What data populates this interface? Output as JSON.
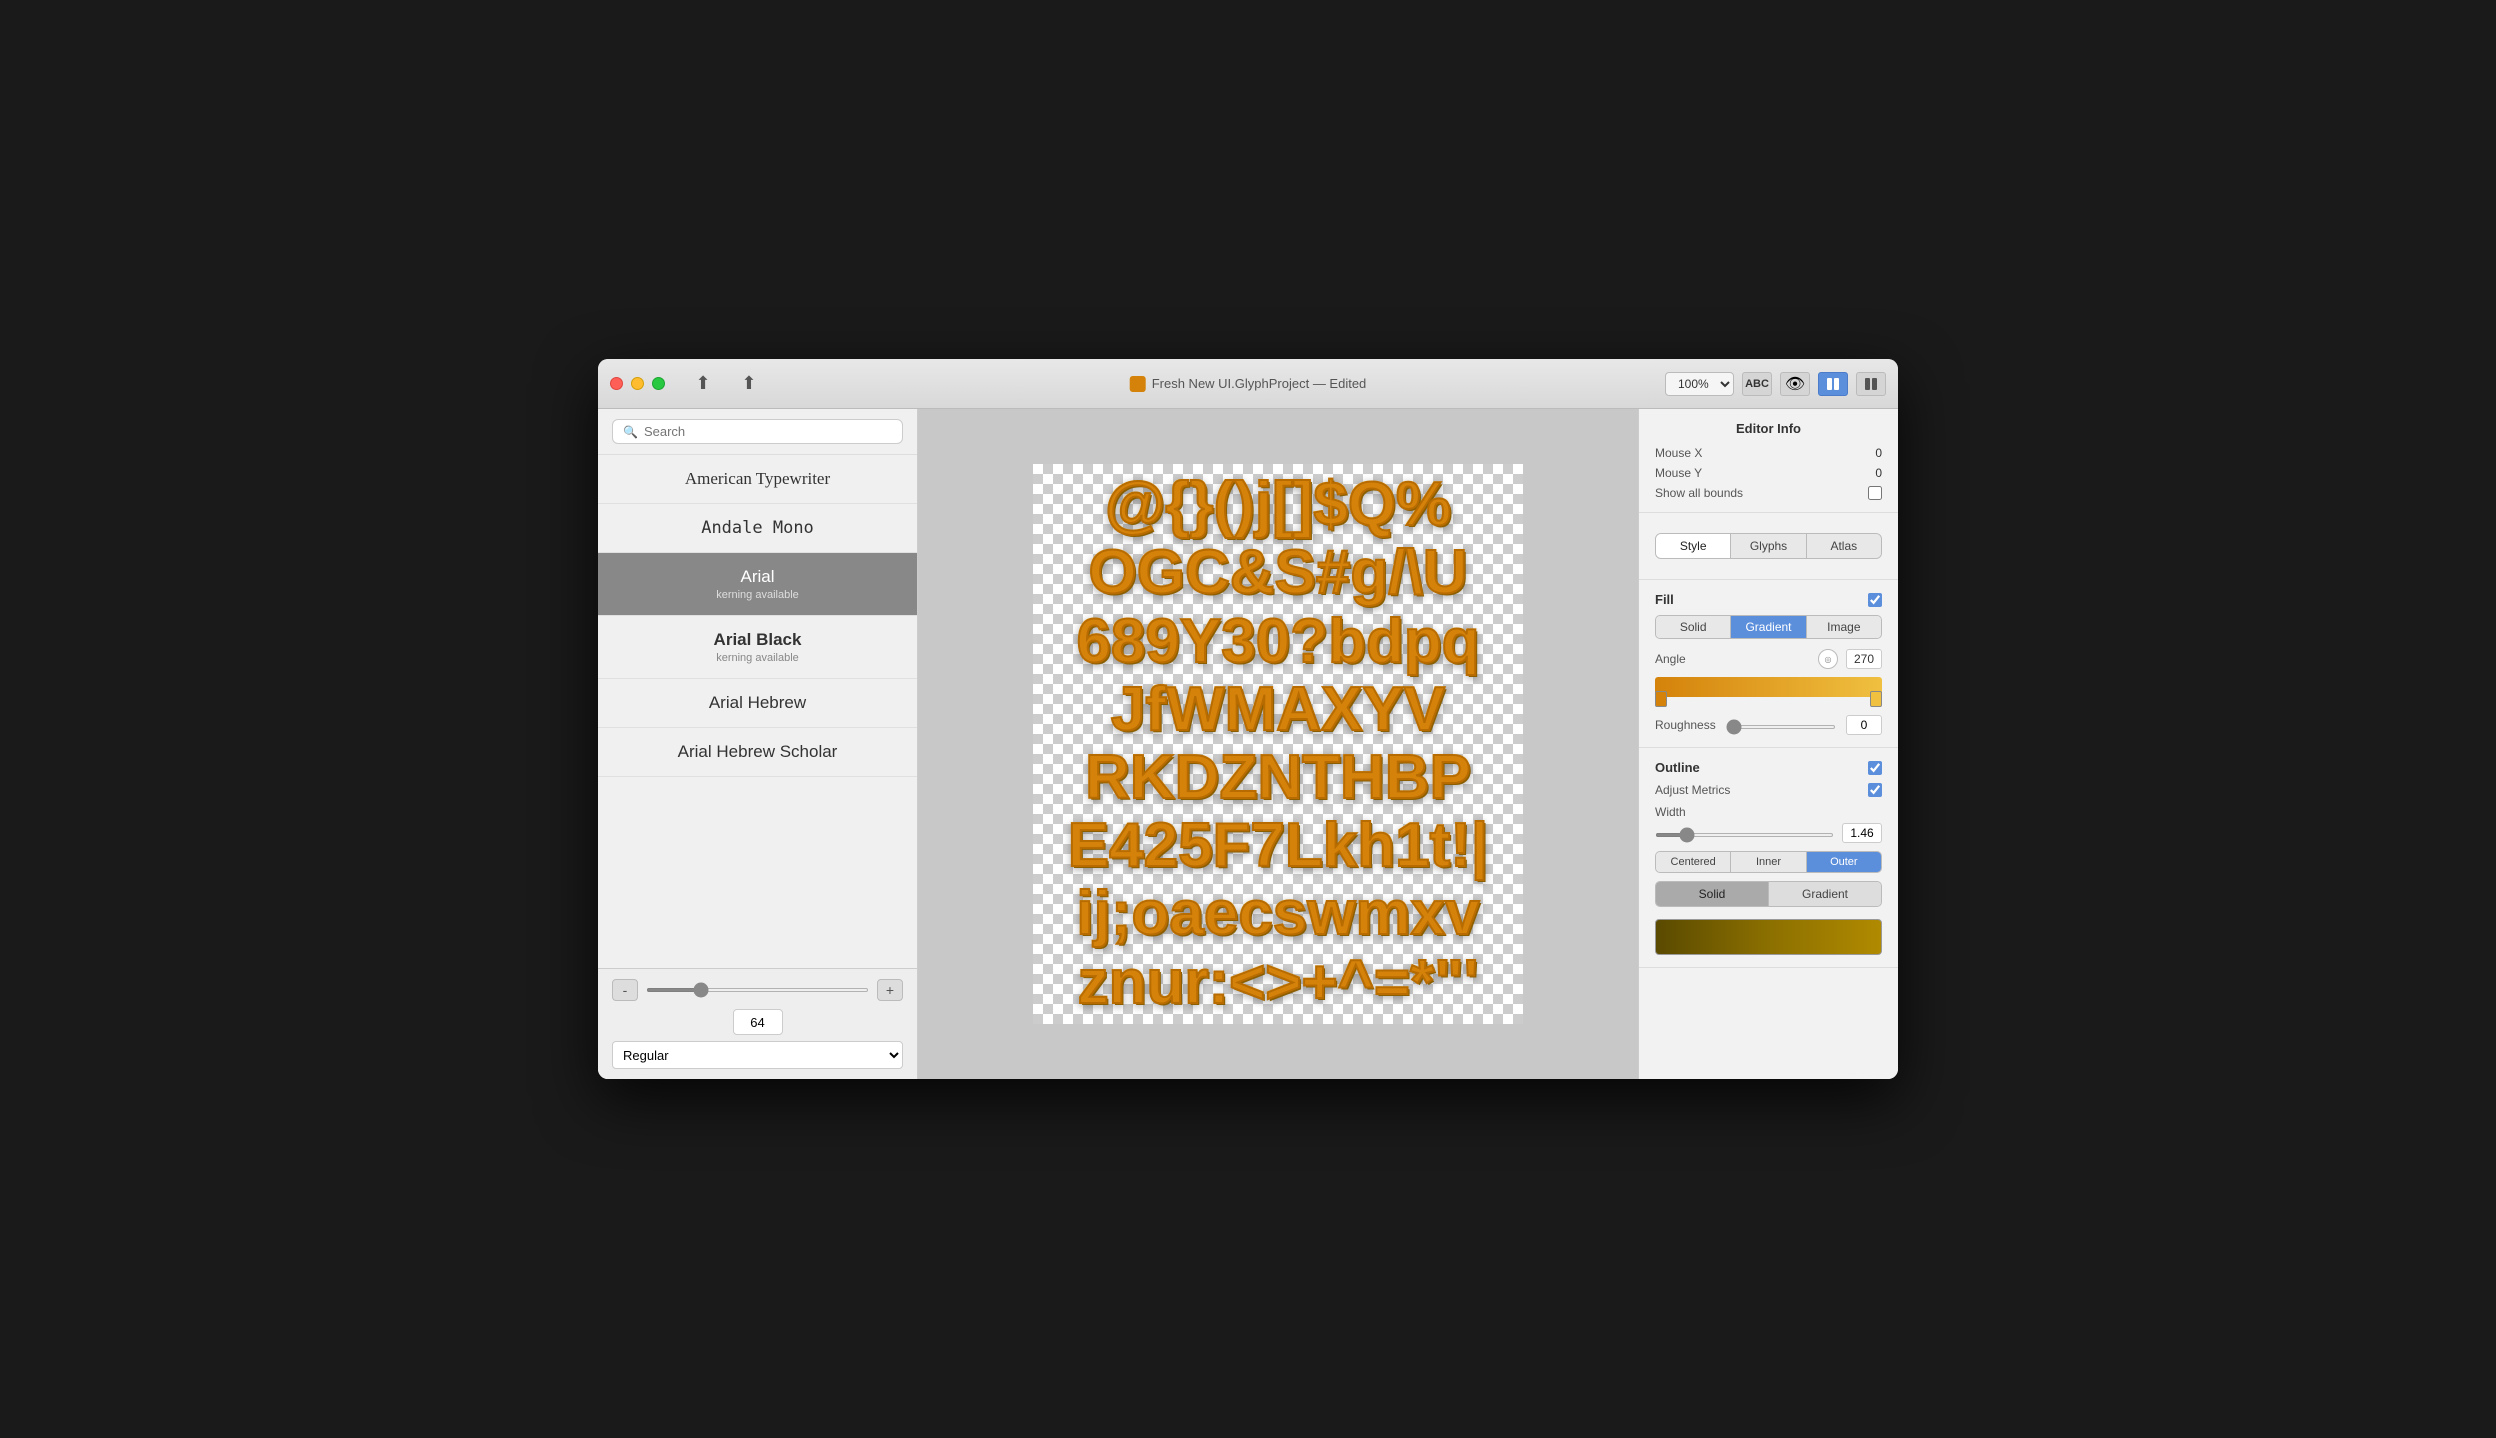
{
  "window": {
    "title": "Fresh New UI.GlyphProject — Edited",
    "zoom": "100%"
  },
  "titlebar": {
    "upload_btn": "⬆",
    "share_btn": "⬆",
    "zoom_label": "100%",
    "title_text": "Fresh New UI.GlyphProject — Edited"
  },
  "sidebar": {
    "search_placeholder": "Search",
    "fonts": [
      {
        "name": "American Typewriter",
        "sub": "",
        "selected": false,
        "class": "font-american"
      },
      {
        "name": "Andale Mono",
        "sub": "",
        "selected": false,
        "class": "font-andale"
      },
      {
        "name": "Arial",
        "sub": "kerning available",
        "selected": true,
        "class": "font-arial"
      },
      {
        "name": "Arial Black",
        "sub": "kerning available",
        "selected": false,
        "class": "font-arial-black"
      },
      {
        "name": "Arial Hebrew",
        "sub": "",
        "selected": false,
        "class": "font-arial-hebrew"
      },
      {
        "name": "Arial Hebrew Scholar",
        "sub": "",
        "selected": false,
        "class": "font-arial-hebrew-scholar"
      }
    ],
    "size_value": "64",
    "style_value": "Regular",
    "minus_label": "-",
    "plus_label": "+"
  },
  "canvas": {
    "glyph_text_line1": "@{}()j[  ]$Q%",
    "glyph_text_line2": "OGC&S#g/\\U",
    "glyph_text_line3": "689Y30?bdpq",
    "glyph_text_line4": "JfWMAXYV",
    "glyph_text_line5": "RKDZNTHBP",
    "glyph_text_line6": "E425F7Lkh1t!|",
    "glyph_text_line7": "ij;oaecswmxv",
    "glyph_text_line8": "znur:<>+^=*\"\"'"
  },
  "right_panel": {
    "editor_info_title": "Editor Info",
    "mouse_x_label": "Mouse X",
    "mouse_x_value": "0",
    "mouse_y_label": "Mouse Y",
    "mouse_y_value": "0",
    "show_bounds_label": "Show all bounds",
    "tabs": [
      "Style",
      "Glyphs",
      "Atlas"
    ],
    "active_tab": "Style",
    "fill_label": "Fill",
    "fill_tabs": [
      "Solid",
      "Gradient",
      "Image"
    ],
    "active_fill_tab": "Gradient",
    "angle_label": "Angle",
    "angle_value": "270",
    "roughness_label": "Roughness",
    "roughness_value": "0",
    "outline_label": "Outline",
    "adjust_metrics_label": "Adjust Metrics",
    "width_label": "Width",
    "width_value": "1.46",
    "position_tabs": [
      "Centered",
      "Inner",
      "Outer"
    ],
    "active_position": "Outer",
    "style_tabs": [
      "Solid",
      "Gradient"
    ],
    "active_style_tab": "Solid"
  }
}
